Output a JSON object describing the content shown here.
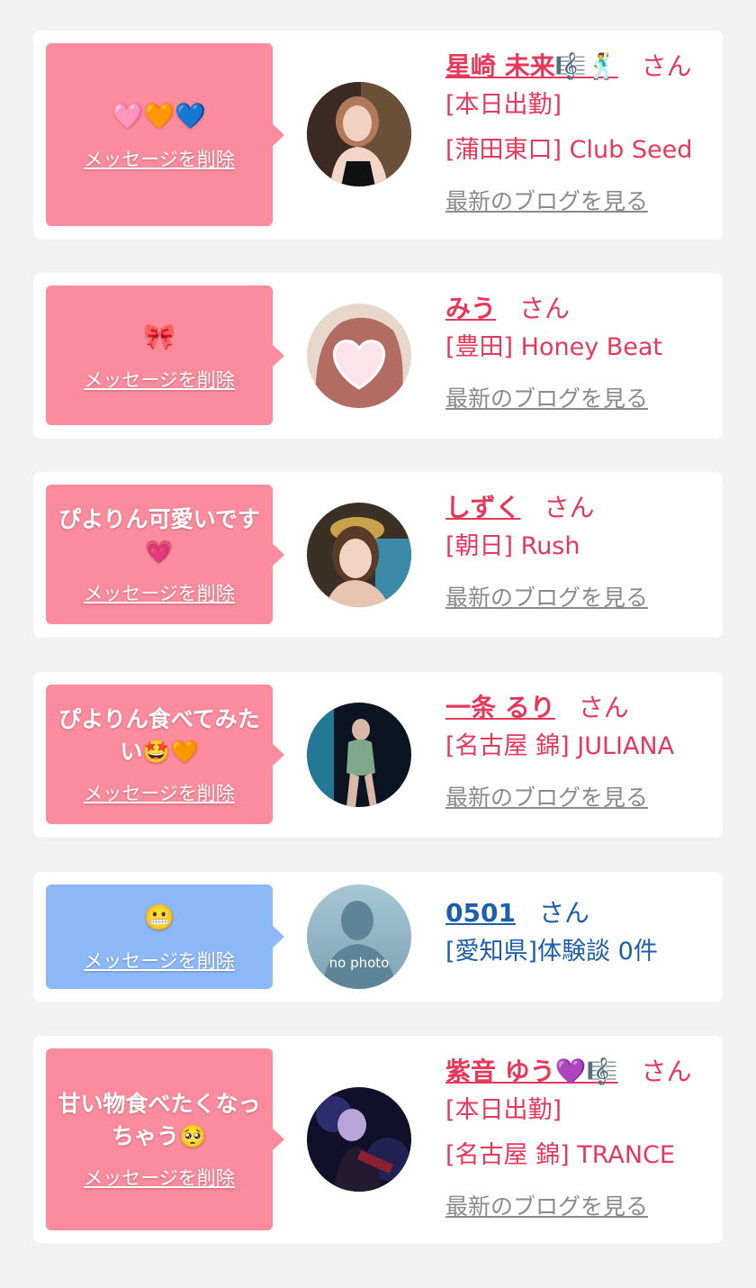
{
  "common": {
    "delete_label": "メッセージを削除",
    "san": "さん",
    "blog_label": "最新のブログを見る"
  },
  "cards": [
    {
      "message": "🩷🧡💙",
      "bubble_color": "pink",
      "name": "星崎 未来🎼🕺",
      "lines": [
        "[本日出勤]",
        "[蒲田東口] Club Seed"
      ],
      "blog": true
    },
    {
      "message": "🎀",
      "bubble_color": "pink",
      "name": "みう",
      "lines": [
        "[豊田] Honey Beat"
      ],
      "blog": true
    },
    {
      "message": "ぴよりん可愛いです💗",
      "bubble_color": "pink",
      "name": "しずく",
      "lines": [
        "[朝日] Rush"
      ],
      "blog": true
    },
    {
      "message": "ぴよりん食べてみたい🤩🧡",
      "bubble_color": "pink",
      "name": "一条 るり",
      "lines": [
        "[名古屋 錦] JULIANA"
      ],
      "blog": true
    },
    {
      "message": "😬",
      "bubble_color": "blue",
      "name": "0501",
      "lines": [
        "[愛知県]体験談 0件"
      ],
      "avatar_text": "no photo",
      "blog": false
    },
    {
      "message": "甘い物食べたくなっちゃう🥺",
      "bubble_color": "pink",
      "name": "紫音 ゆう💜🎼",
      "lines": [
        "[本日出勤]",
        "[名古屋 錦] TRANCE"
      ],
      "blog": true
    }
  ]
}
